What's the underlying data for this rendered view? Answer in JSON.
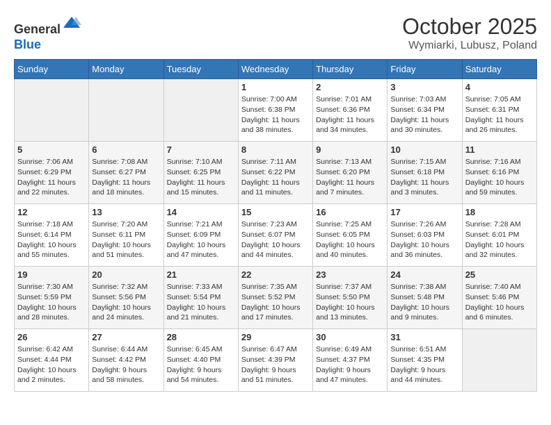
{
  "header": {
    "logo_line1": "General",
    "logo_line2": "Blue",
    "month_title": "October 2025",
    "location": "Wymiarki, Lubusz, Poland"
  },
  "weekdays": [
    "Sunday",
    "Monday",
    "Tuesday",
    "Wednesday",
    "Thursday",
    "Friday",
    "Saturday"
  ],
  "weeks": [
    [
      {
        "day": "",
        "info": ""
      },
      {
        "day": "",
        "info": ""
      },
      {
        "day": "",
        "info": ""
      },
      {
        "day": "1",
        "info": "Sunrise: 7:00 AM\nSunset: 6:38 PM\nDaylight: 11 hours\nand 38 minutes."
      },
      {
        "day": "2",
        "info": "Sunrise: 7:01 AM\nSunset: 6:36 PM\nDaylight: 11 hours\nand 34 minutes."
      },
      {
        "day": "3",
        "info": "Sunrise: 7:03 AM\nSunset: 6:34 PM\nDaylight: 11 hours\nand 30 minutes."
      },
      {
        "day": "4",
        "info": "Sunrise: 7:05 AM\nSunset: 6:31 PM\nDaylight: 11 hours\nand 26 minutes."
      }
    ],
    [
      {
        "day": "5",
        "info": "Sunrise: 7:06 AM\nSunset: 6:29 PM\nDaylight: 11 hours\nand 22 minutes."
      },
      {
        "day": "6",
        "info": "Sunrise: 7:08 AM\nSunset: 6:27 PM\nDaylight: 11 hours\nand 18 minutes."
      },
      {
        "day": "7",
        "info": "Sunrise: 7:10 AM\nSunset: 6:25 PM\nDaylight: 11 hours\nand 15 minutes."
      },
      {
        "day": "8",
        "info": "Sunrise: 7:11 AM\nSunset: 6:22 PM\nDaylight: 11 hours\nand 11 minutes."
      },
      {
        "day": "9",
        "info": "Sunrise: 7:13 AM\nSunset: 6:20 PM\nDaylight: 11 hours\nand 7 minutes."
      },
      {
        "day": "10",
        "info": "Sunrise: 7:15 AM\nSunset: 6:18 PM\nDaylight: 11 hours\nand 3 minutes."
      },
      {
        "day": "11",
        "info": "Sunrise: 7:16 AM\nSunset: 6:16 PM\nDaylight: 10 hours\nand 59 minutes."
      }
    ],
    [
      {
        "day": "12",
        "info": "Sunrise: 7:18 AM\nSunset: 6:14 PM\nDaylight: 10 hours\nand 55 minutes."
      },
      {
        "day": "13",
        "info": "Sunrise: 7:20 AM\nSunset: 6:11 PM\nDaylight: 10 hours\nand 51 minutes."
      },
      {
        "day": "14",
        "info": "Sunrise: 7:21 AM\nSunset: 6:09 PM\nDaylight: 10 hours\nand 47 minutes."
      },
      {
        "day": "15",
        "info": "Sunrise: 7:23 AM\nSunset: 6:07 PM\nDaylight: 10 hours\nand 44 minutes."
      },
      {
        "day": "16",
        "info": "Sunrise: 7:25 AM\nSunset: 6:05 PM\nDaylight: 10 hours\nand 40 minutes."
      },
      {
        "day": "17",
        "info": "Sunrise: 7:26 AM\nSunset: 6:03 PM\nDaylight: 10 hours\nand 36 minutes."
      },
      {
        "day": "18",
        "info": "Sunrise: 7:28 AM\nSunset: 6:01 PM\nDaylight: 10 hours\nand 32 minutes."
      }
    ],
    [
      {
        "day": "19",
        "info": "Sunrise: 7:30 AM\nSunset: 5:59 PM\nDaylight: 10 hours\nand 28 minutes."
      },
      {
        "day": "20",
        "info": "Sunrise: 7:32 AM\nSunset: 5:56 PM\nDaylight: 10 hours\nand 24 minutes."
      },
      {
        "day": "21",
        "info": "Sunrise: 7:33 AM\nSunset: 5:54 PM\nDaylight: 10 hours\nand 21 minutes."
      },
      {
        "day": "22",
        "info": "Sunrise: 7:35 AM\nSunset: 5:52 PM\nDaylight: 10 hours\nand 17 minutes."
      },
      {
        "day": "23",
        "info": "Sunrise: 7:37 AM\nSunset: 5:50 PM\nDaylight: 10 hours\nand 13 minutes."
      },
      {
        "day": "24",
        "info": "Sunrise: 7:38 AM\nSunset: 5:48 PM\nDaylight: 10 hours\nand 9 minutes."
      },
      {
        "day": "25",
        "info": "Sunrise: 7:40 AM\nSunset: 5:46 PM\nDaylight: 10 hours\nand 6 minutes."
      }
    ],
    [
      {
        "day": "26",
        "info": "Sunrise: 6:42 AM\nSunset: 4:44 PM\nDaylight: 10 hours\nand 2 minutes."
      },
      {
        "day": "27",
        "info": "Sunrise: 6:44 AM\nSunset: 4:42 PM\nDaylight: 9 hours\nand 58 minutes."
      },
      {
        "day": "28",
        "info": "Sunrise: 6:45 AM\nSunset: 4:40 PM\nDaylight: 9 hours\nand 54 minutes."
      },
      {
        "day": "29",
        "info": "Sunrise: 6:47 AM\nSunset: 4:39 PM\nDaylight: 9 hours\nand 51 minutes."
      },
      {
        "day": "30",
        "info": "Sunrise: 6:49 AM\nSunset: 4:37 PM\nDaylight: 9 hours\nand 47 minutes."
      },
      {
        "day": "31",
        "info": "Sunrise: 6:51 AM\nSunset: 4:35 PM\nDaylight: 9 hours\nand 44 minutes."
      },
      {
        "day": "",
        "info": ""
      }
    ]
  ]
}
